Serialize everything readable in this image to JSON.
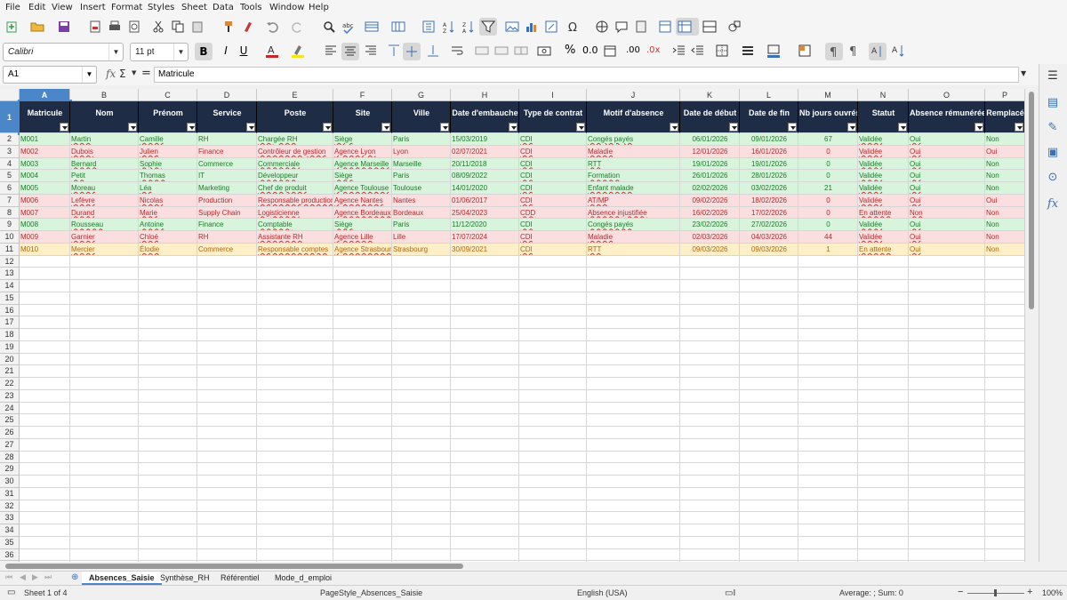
{
  "menu": [
    "File",
    "Edit",
    "View",
    "Insert",
    "Format",
    "Styles",
    "Sheet",
    "Data",
    "Tools",
    "Window",
    "Help"
  ],
  "font_name": "Calibri",
  "font_size": "11 pt",
  "name_box": "A1",
  "formula": "Matricule",
  "columns": [
    "A",
    "B",
    "C",
    "D",
    "E",
    "F",
    "G",
    "H",
    "I",
    "J",
    "K",
    "L",
    "M",
    "N",
    "O",
    "P"
  ],
  "headers": [
    "Matricule",
    "Nom",
    "Prénom",
    "Service",
    "Poste",
    "Site",
    "Ville",
    "Date d'embauche",
    "Type de contrat",
    "Motif d'absence",
    "Date de début",
    "Date de fin",
    "Nb jours ouvrés",
    "Statut",
    "Absence rémunérée",
    "Remplacé"
  ],
  "rows": [
    {
      "status": "green",
      "cells": [
        "M001",
        "Martin",
        "Camille",
        "RH",
        "Chargée RH",
        "Siège",
        "Paris",
        "15/03/2019",
        "CDI",
        "Congés payés",
        "06/01/2026",
        "09/01/2026",
        "67",
        "Validée",
        "Oui",
        "Non"
      ]
    },
    {
      "status": "red",
      "cells": [
        "M002",
        "Dubois",
        "Julien",
        "Finance",
        "Contrôleur de gestion",
        "Agence Lyon",
        "Lyon",
        "02/07/2021",
        "CDI",
        "Maladie",
        "12/01/2026",
        "16/01/2026",
        "0",
        "Validée",
        "Oui",
        "Oui"
      ]
    },
    {
      "status": "green",
      "cells": [
        "M003",
        "Bernard",
        "Sophie",
        "Commerce",
        "Commerciale",
        "Agence Marseille",
        "Marseille",
        "20/11/2018",
        "CDI",
        "RTT",
        "19/01/2026",
        "19/01/2026",
        "0",
        "Validée",
        "Oui",
        "Non"
      ]
    },
    {
      "status": "green",
      "cells": [
        "M004",
        "Petit",
        "Thomas",
        "IT",
        "Développeur",
        "Siège",
        "Paris",
        "08/09/2022",
        "CDI",
        "Formation",
        "26/01/2026",
        "28/01/2026",
        "0",
        "Validée",
        "Oui",
        "Non"
      ]
    },
    {
      "status": "green",
      "cells": [
        "M005",
        "Moreau",
        "Léa",
        "Marketing",
        "Chef de produit",
        "Agence Toulouse",
        "Toulouse",
        "14/01/2020",
        "CDI",
        "Enfant malade",
        "02/02/2026",
        "03/02/2026",
        "21",
        "Validée",
        "Oui",
        "Non"
      ]
    },
    {
      "status": "red",
      "cells": [
        "M006",
        "Lefèvre",
        "Nicolas",
        "Production",
        "Responsable production",
        "Agence Nantes",
        "Nantes",
        "01/06/2017",
        "CDI",
        "AT/MP",
        "09/02/2026",
        "18/02/2026",
        "0",
        "Validée",
        "Oui",
        "Oui"
      ]
    },
    {
      "status": "red",
      "cells": [
        "M007",
        "Durand",
        "Marie",
        "Supply Chain",
        "Logisticienne",
        "Agence Bordeaux",
        "Bordeaux",
        "25/04/2023",
        "CDD",
        "Absence injustifiée",
        "16/02/2026",
        "17/02/2026",
        "0",
        "En attente",
        "Non",
        "Non"
      ]
    },
    {
      "status": "green",
      "cells": [
        "M008",
        "Rousseau",
        "Antoine",
        "Finance",
        "Comptable",
        "Siège",
        "Paris",
        "11/12/2020",
        "CDI",
        "Congés payés",
        "23/02/2026",
        "27/02/2026",
        "0",
        "Validée",
        "Oui",
        "Non"
      ]
    },
    {
      "status": "red",
      "cells": [
        "M009",
        "Garnier",
        "Chloé",
        "RH",
        "Assistante RH",
        "Agence Lille",
        "Lille",
        "17/07/2024",
        "CDI",
        "Maladie",
        "02/03/2026",
        "04/03/2026",
        "44",
        "Validée",
        "Oui",
        "Non"
      ]
    },
    {
      "status": "yellow",
      "cells": [
        "M010",
        "Mercier",
        "Élodie",
        "Commerce",
        "Responsable comptes",
        "Agence Strasbourg",
        "Strasbourg",
        "30/09/2021",
        "CDI",
        "RTT",
        "09/03/2026",
        "09/03/2026",
        "1",
        "En attente",
        "Oui",
        "Non"
      ]
    }
  ],
  "row_numbers": [
    "1",
    "2",
    "3",
    "4",
    "5",
    "6",
    "7",
    "8",
    "9",
    "10",
    "11",
    "12",
    "13",
    "14",
    "15",
    "16",
    "17",
    "18",
    "19",
    "20",
    "21",
    "22",
    "23",
    "24",
    "25",
    "26",
    "27",
    "28",
    "29",
    "30",
    "31",
    "32",
    "33",
    "34",
    "35",
    "36",
    "37"
  ],
  "tabs": [
    "Absences_Saisie",
    "Synthèse_RH",
    "Référentiel",
    "Mode_d_emploi"
  ],
  "status": {
    "sheet": "Sheet 1 of 4",
    "page_style": "PageStyle_Absences_Saisie",
    "language": "English (USA)",
    "summary": "Average: ; Sum: 0",
    "zoom": "100%"
  },
  "colors": {
    "header_bg": "#1f2c45",
    "green_bg": "#d8f4dc",
    "red_bg": "#fbdfe0",
    "yellow_bg": "#fdefc7",
    "selection": "#4a86c8"
  }
}
